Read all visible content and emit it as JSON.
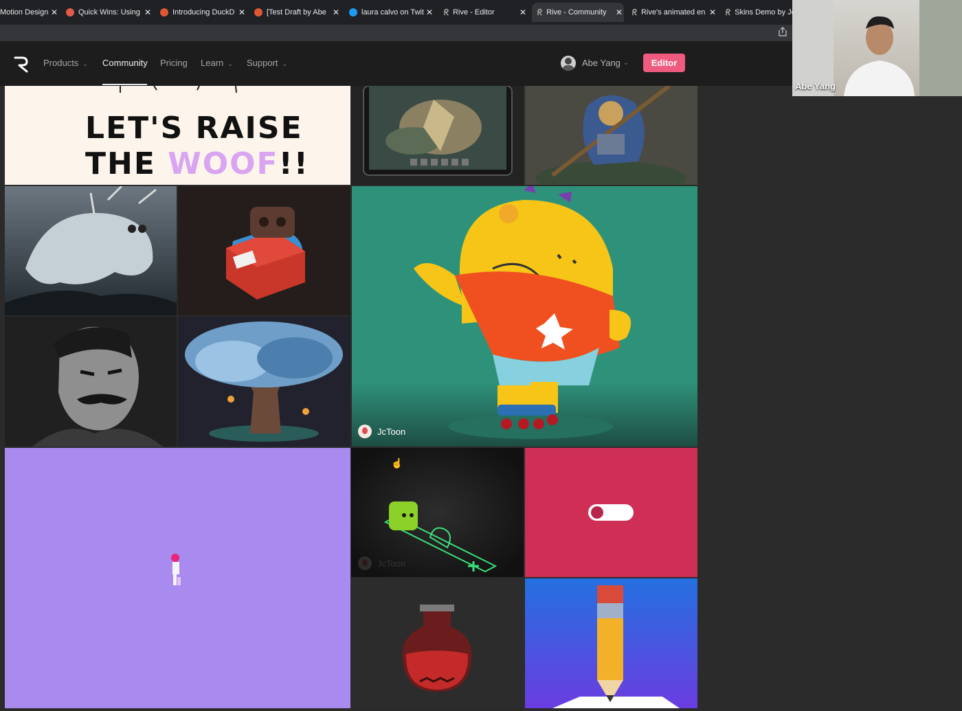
{
  "browser": {
    "tabs": [
      {
        "title": "Motion Design",
        "close": "✕"
      },
      {
        "title": "Quick Wins: Using",
        "close": "✕"
      },
      {
        "title": "Introducing DuckD",
        "close": "✕"
      },
      {
        "title": "[Test Draft by Abe",
        "close": "✕"
      },
      {
        "title": "laura calvo on Twit",
        "close": "✕"
      },
      {
        "title": "Rive - Editor",
        "close": "✕"
      },
      {
        "title": "Rive - Community",
        "close": "✕"
      },
      {
        "title": "Rive's animated en",
        "close": "✕"
      },
      {
        "title": "Skins Demo by Jc",
        "close": ""
      }
    ],
    "share_icon": "share-icon"
  },
  "nav": {
    "items": [
      {
        "label": "Products",
        "chevron": "⌄"
      },
      {
        "label": "Community",
        "chevron": ""
      },
      {
        "label": "Pricing",
        "chevron": ""
      },
      {
        "label": "Learn",
        "chevron": "⌄"
      },
      {
        "label": "Support",
        "chevron": "⌄"
      }
    ],
    "user_name": "Abe Yang",
    "user_chevron": "⌄",
    "editor_label": "Editor"
  },
  "gallery": {
    "banner": {
      "line1": "LET'S RAISE",
      "line2_a": "THE ",
      "line2_b": "WOOF",
      "line2_c": "!!"
    },
    "featured_credit": "JcToon",
    "faded_credit": "JcToon"
  },
  "video": {
    "participant_name": "Abe Yang"
  },
  "colors": {
    "accent": "#ef5b7f",
    "purple_tile": "#a98aee",
    "pink_tile": "#cf2f55",
    "teal_tile": "#2e927a",
    "blue_tile": "#2b6fd8"
  }
}
